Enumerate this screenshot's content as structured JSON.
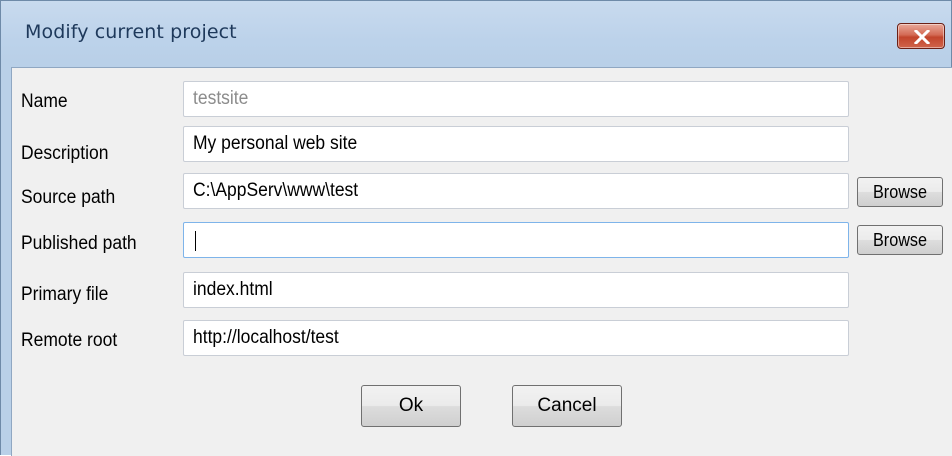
{
  "window": {
    "title": "Modify current project"
  },
  "form": {
    "name": {
      "label": "Name",
      "value": "testsite"
    },
    "description": {
      "label": "Description",
      "value": "My personal web site"
    },
    "source_path": {
      "label": "Source path",
      "value": "C:\\AppServ\\www\\test",
      "browse_label": "Browse"
    },
    "published_path": {
      "label": "Published path",
      "value": "",
      "browse_label": "Browse"
    },
    "primary_file": {
      "label": "Primary file",
      "value": "index.html"
    },
    "remote_root": {
      "label": "Remote root",
      "value": "http://localhost/test"
    }
  },
  "buttons": {
    "ok": "Ok",
    "cancel": "Cancel"
  },
  "icons": {
    "close": "close-icon"
  },
  "colors": {
    "titlebar": "#bcd2ea",
    "title_text": "#1e395b",
    "close_button": "#c7462e",
    "client_bg": "#f0f0f0",
    "focus_border": "#7eb4ea"
  }
}
